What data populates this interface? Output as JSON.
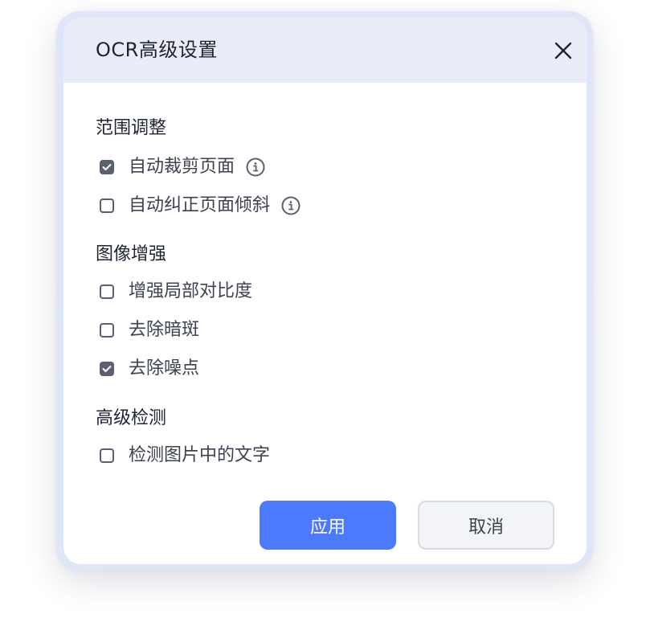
{
  "dialog": {
    "title": "OCR高级设置"
  },
  "sections": [
    {
      "title": "范围调整",
      "options": [
        {
          "label": "自动裁剪页面",
          "checked": true,
          "info_icon": "info-circle-icon"
        },
        {
          "label": "自动纠正页面倾斜",
          "checked": false,
          "info_icon": "info-circle-icon"
        }
      ]
    },
    {
      "title": "图像增强",
      "options": [
        {
          "label": "增强局部对比度",
          "checked": false
        },
        {
          "label": "去除暗斑",
          "checked": false
        },
        {
          "label": "去除噪点",
          "checked": true
        }
      ]
    },
    {
      "title": "高级检测",
      "options": [
        {
          "label": "检测图片中的文字",
          "checked": false
        }
      ]
    }
  ],
  "buttons": {
    "apply_label": "应用",
    "cancel_label": "取消"
  },
  "colors": {
    "accent": "#4b7afc",
    "header_bg": "#e8edf8",
    "checkbox": "#5a6070"
  }
}
